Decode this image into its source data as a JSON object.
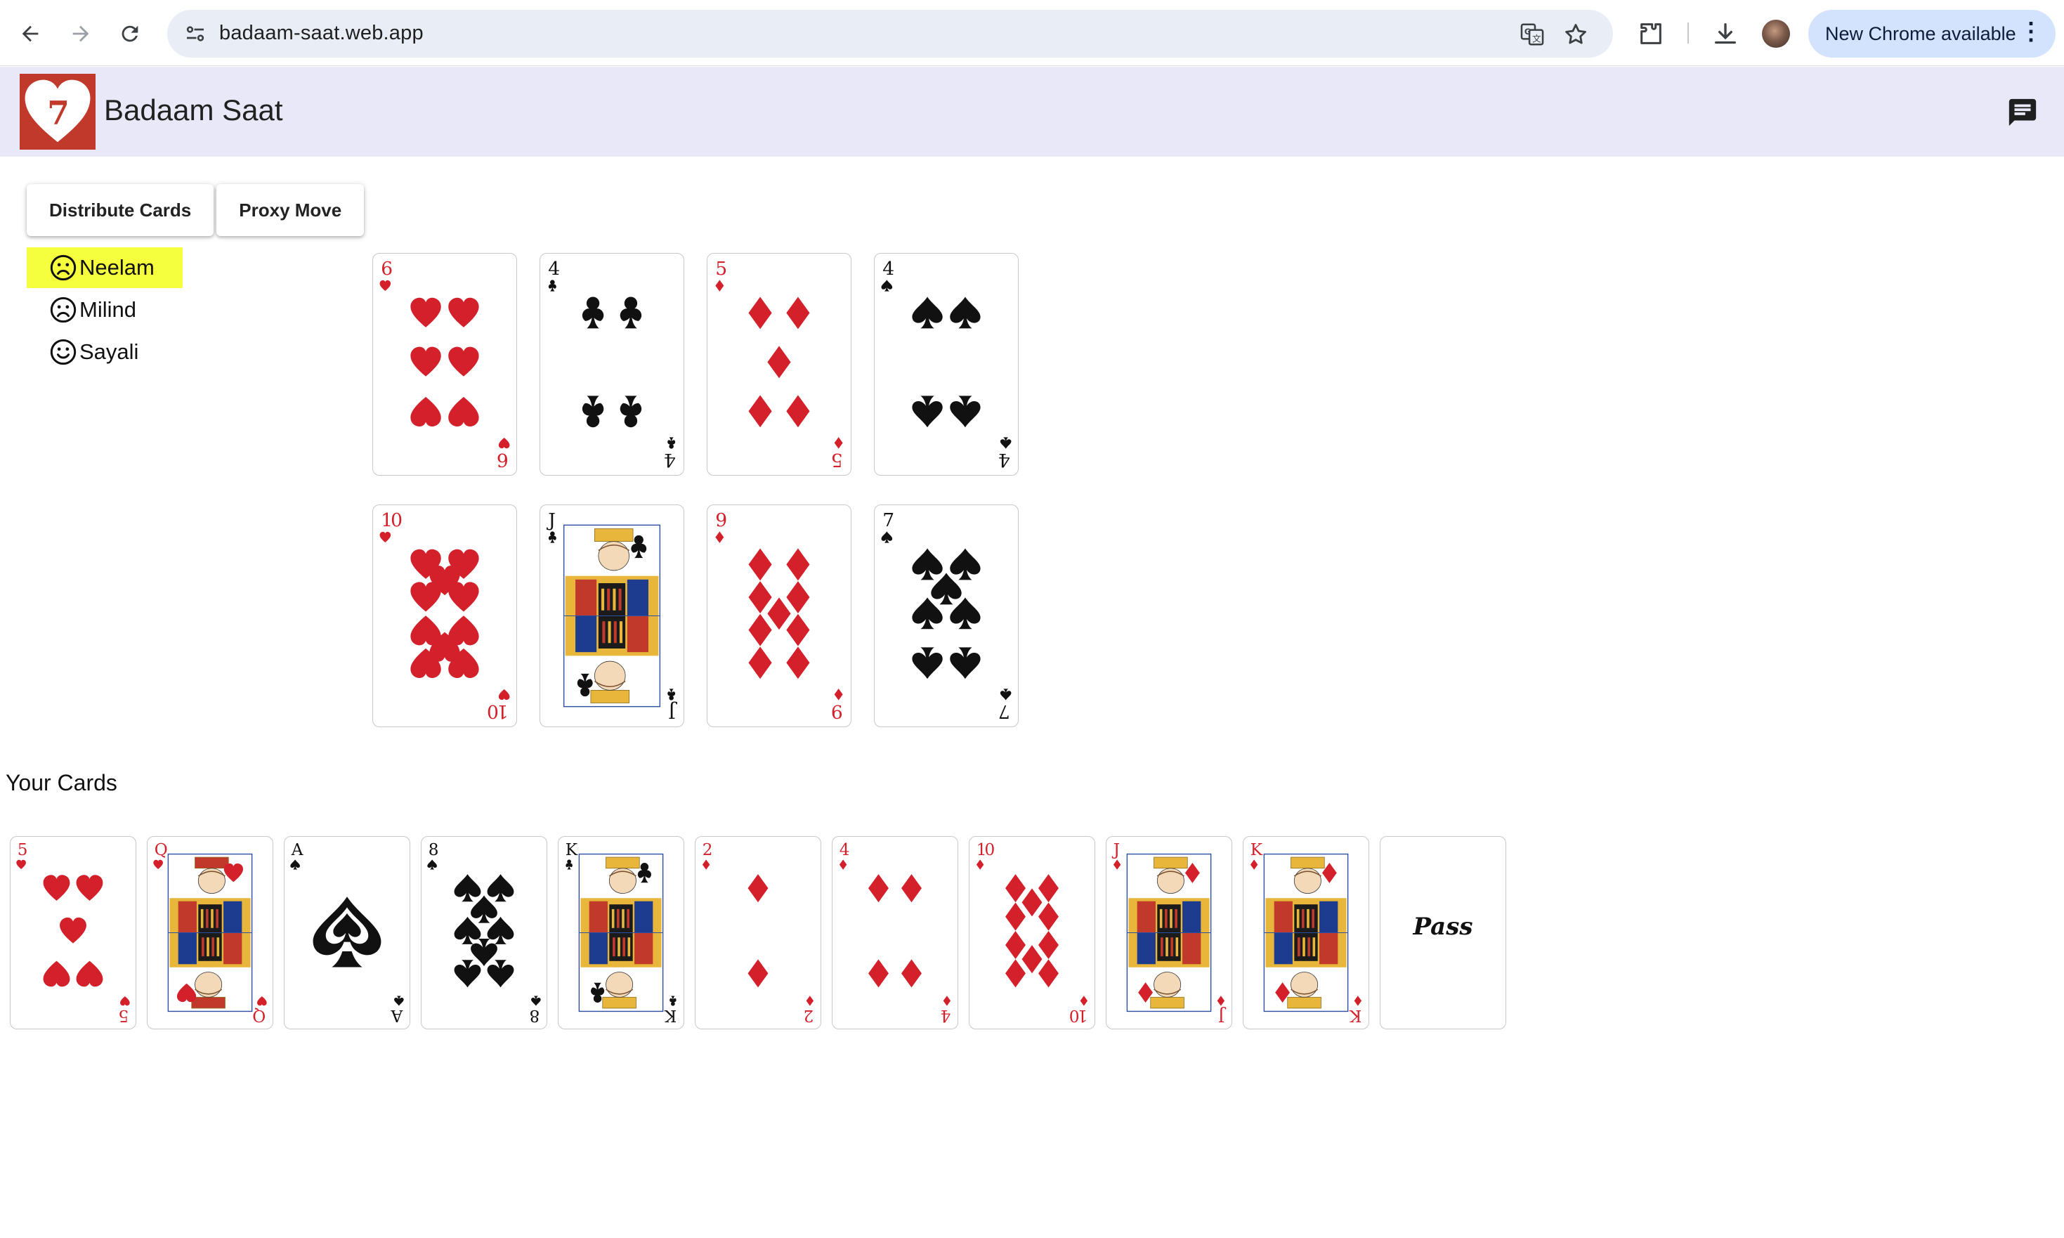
{
  "browser": {
    "url": "badaam-saat.web.app",
    "update_label": "New Chrome available",
    "icons": [
      "back-arrow-icon",
      "forward-arrow-icon",
      "reload-icon",
      "site-info-icon",
      "translate-icon",
      "bookmark-star-icon",
      "extensions-icon",
      "download-icon",
      "profile-avatar",
      "more-vert-icon"
    ]
  },
  "app": {
    "title": "Badaam Saat",
    "logo_rank": "7",
    "chat_icon": "chat-icon"
  },
  "toolbar": {
    "distribute_label": "Distribute Cards",
    "proxy_label": "Proxy Move"
  },
  "players": [
    {
      "name": "Neelam",
      "mood": "sad",
      "active": true
    },
    {
      "name": "Milind",
      "mood": "sad",
      "active": false
    },
    {
      "name": "Sayali",
      "mood": "happy",
      "active": false
    }
  ],
  "table": {
    "cards": [
      {
        "rank": "6",
        "suit": "hearts"
      },
      {
        "rank": "4",
        "suit": "clubs"
      },
      {
        "rank": "5",
        "suit": "diamonds"
      },
      {
        "rank": "4",
        "suit": "spades"
      },
      {
        "rank": "10",
        "suit": "hearts"
      },
      {
        "rank": "J",
        "suit": "clubs"
      },
      {
        "rank": "9",
        "suit": "diamonds"
      },
      {
        "rank": "7",
        "suit": "spades"
      }
    ]
  },
  "hand": {
    "heading": "Your Cards",
    "cards": [
      {
        "rank": "5",
        "suit": "hearts"
      },
      {
        "rank": "Q",
        "suit": "hearts"
      },
      {
        "rank": "A",
        "suit": "spades"
      },
      {
        "rank": "8",
        "suit": "spades"
      },
      {
        "rank": "K",
        "suit": "clubs"
      },
      {
        "rank": "2",
        "suit": "diamonds"
      },
      {
        "rank": "4",
        "suit": "diamonds"
      },
      {
        "rank": "10",
        "suit": "diamonds"
      },
      {
        "rank": "J",
        "suit": "diamonds"
      },
      {
        "rank": "K",
        "suit": "diamonds"
      }
    ],
    "pass_label": "Pass"
  },
  "colors": {
    "red_suit": "#d3202a",
    "black_suit": "#111111",
    "appbar_bg": "#e8e8f8",
    "active_player_bg": "#f6ff3e",
    "chip_bg": "#d3e3fd"
  }
}
